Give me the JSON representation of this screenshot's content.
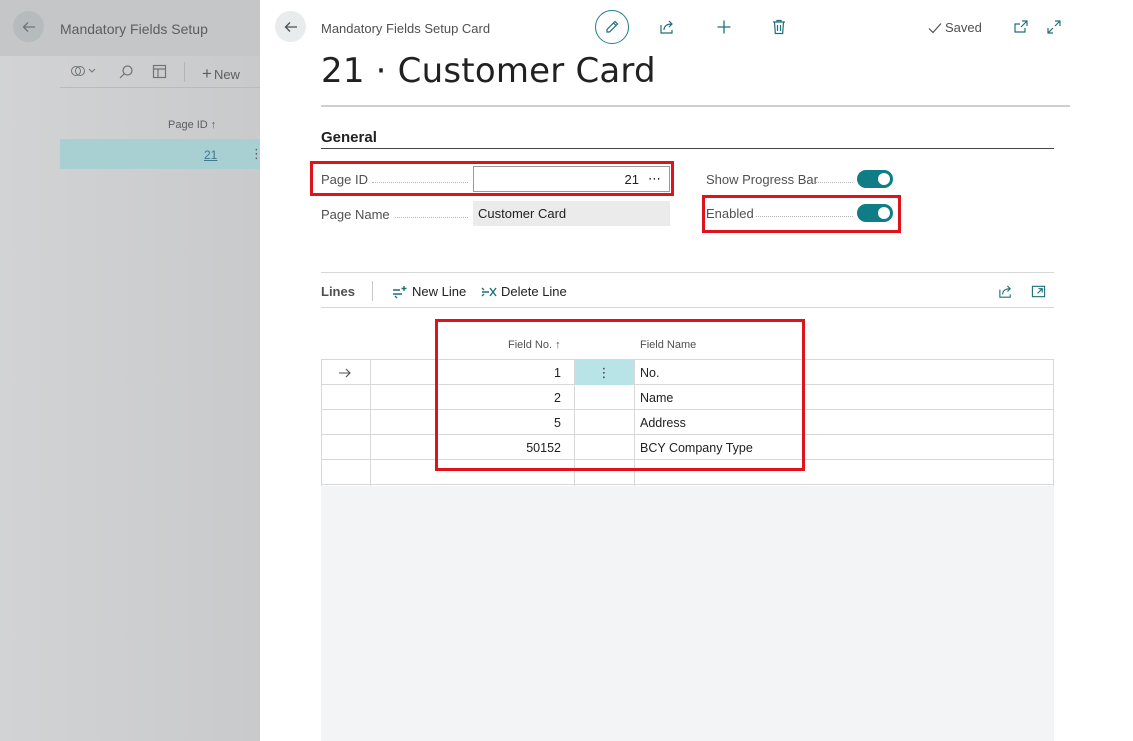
{
  "background": {
    "title": "Mandatory Fields Setup",
    "toolbar": {
      "new_label": "New"
    },
    "column_header": "Page ID ↑",
    "rows": [
      {
        "page_id": "21"
      }
    ]
  },
  "card": {
    "caption": "Mandatory Fields Setup Card",
    "saved_label": "Saved",
    "title": "21 · Customer Card",
    "general": {
      "section_title": "General",
      "page_id_label": "Page ID",
      "page_id_value": "21",
      "page_name_label": "Page Name",
      "page_name_value": "Customer Card",
      "show_progress_label": "Show Progress Bar",
      "show_progress_value": true,
      "enabled_label": "Enabled",
      "enabled_value": true
    },
    "lines": {
      "title": "Lines",
      "new_line_label": "New Line",
      "delete_line_label": "Delete Line",
      "columns": {
        "field_no": "Field No. ↑",
        "field_name": "Field Name"
      },
      "rows": [
        {
          "field_no": "1",
          "field_name": "No."
        },
        {
          "field_no": "2",
          "field_name": "Name"
        },
        {
          "field_no": "5",
          "field_name": "Address"
        },
        {
          "field_no": "50152",
          "field_name": "BCY Company Type"
        }
      ]
    }
  },
  "colors": {
    "accent": "#0f7c86",
    "highlight": "#e0121b",
    "selected_row": "#b8e4e8"
  },
  "icons": [
    "back-arrow-icon",
    "edit-icon",
    "share-icon",
    "plus-icon",
    "trash-icon",
    "check-icon",
    "popout-icon",
    "expand-icon",
    "filter-icon",
    "search-icon",
    "layout-icon",
    "new-line-icon",
    "delete-line-icon",
    "row-arrow-icon"
  ]
}
